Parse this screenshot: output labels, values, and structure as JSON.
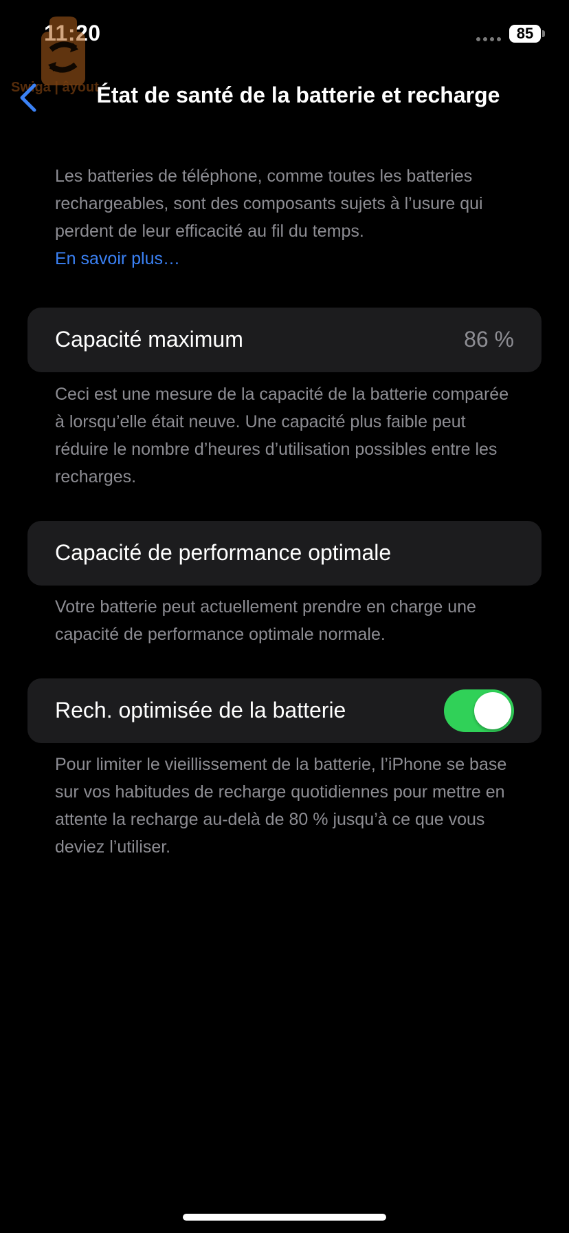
{
  "status_bar": {
    "time": "11:20",
    "battery_level": "85"
  },
  "watermark": {
    "text": "Swiga | âyout"
  },
  "nav": {
    "back_icon": "chevron-left-icon",
    "title": "État de santé de la batterie et recharge"
  },
  "intro": {
    "text": "Les batteries de téléphone, comme toutes les batteries rechargeables, sont des composants sujets à l’usure qui perdent de leur efficacité au fil du temps.",
    "link": "En savoir plus…"
  },
  "max_capacity": {
    "label": "Capacité maximum",
    "value": "86 %",
    "description": "Ceci est une mesure de la capacité de la batterie comparée à lorsqu’elle était neuve. Une capacité plus faible peut réduire le nombre d’heures d’utilisation possibles entre les recharges."
  },
  "peak_performance": {
    "label": "Capacité de performance optimale",
    "description": "Votre batterie peut actuellement prendre en charge une capacité de performance optimale normale."
  },
  "optimized_charging": {
    "label": "Rech. optimisée de la batterie",
    "enabled": true,
    "description": "Pour limiter le vieillissement de la batterie, l’iPhone se base sur vos habitudes de recharge quotidiennes pour mettre en attente la recharge au-delà de 80 % jusqu’à ce que vous deviez l’utiliser."
  },
  "colors": {
    "background": "#000000",
    "card": "#1c1c1e",
    "secondary_text": "#8d8d93",
    "link": "#3b82f6",
    "toggle_on": "#30d158"
  }
}
